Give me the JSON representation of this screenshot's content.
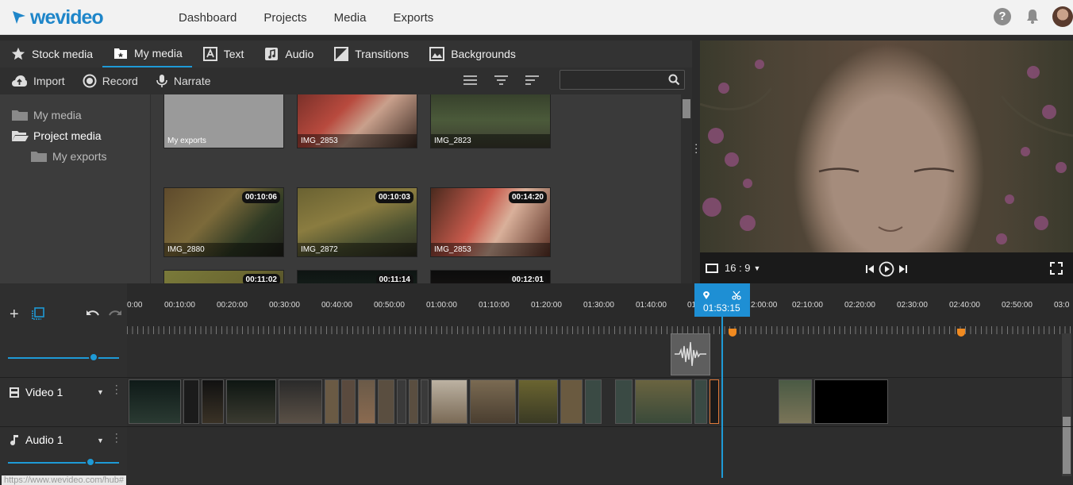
{
  "brand": {
    "logo_text": "wevideo"
  },
  "nav": {
    "items": [
      "Dashboard",
      "Projects",
      "Media",
      "Exports"
    ]
  },
  "media_tabs": [
    "Stock media",
    "My media",
    "Text",
    "Audio",
    "Transitions",
    "Backgrounds"
  ],
  "media_toolbar": {
    "import": "Import",
    "record": "Record",
    "narrate": "Narrate",
    "search_placeholder": ""
  },
  "folders": [
    "My media",
    "Project media",
    "My exports"
  ],
  "thumbs": [
    {
      "name": "My exports",
      "duration": ""
    },
    {
      "name": "IMG_2853",
      "duration": ""
    },
    {
      "name": "IMG_2823",
      "duration": ""
    },
    {
      "name": "IMG_2880",
      "duration": "00:10:06"
    },
    {
      "name": "IMG_2872",
      "duration": "00:10:03"
    },
    {
      "name": "IMG_2853",
      "duration": "00:14:20"
    },
    {
      "name": "",
      "duration": "00:11:02"
    },
    {
      "name": "",
      "duration": "00:11:14"
    },
    {
      "name": "",
      "duration": "00:12:01"
    }
  ],
  "preview": {
    "aspect_ratio": "16 : 9"
  },
  "timeline": {
    "ruler_labels": [
      "0:00",
      "00:10:00",
      "00:20:00",
      "00:30:00",
      "00:40:00",
      "00:50:00",
      "01:00:00",
      "01:10:00",
      "01:20:00",
      "01:30:00",
      "01:40:00",
      "01",
      "2:00:00",
      "02:10:00",
      "02:20:00",
      "02:30:00",
      "02:40:00",
      "02:50:00",
      "03:0"
    ],
    "playhead_time": "01:53:15",
    "video_track": "Video 1",
    "audio_track": "Audio 1"
  },
  "status_url": "https://www.wevideo.com/hub#",
  "accent_color": "#1e9ad6",
  "marker_color": "#f08a20"
}
